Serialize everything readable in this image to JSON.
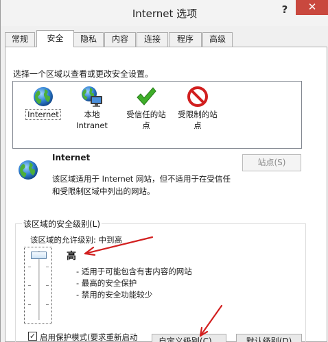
{
  "window": {
    "title": "Internet 选项",
    "help_label": "?",
    "close_label": "✕"
  },
  "tabs": [
    {
      "label": "常规"
    },
    {
      "label": "安全"
    },
    {
      "label": "隐私"
    },
    {
      "label": "内容"
    },
    {
      "label": "连接"
    },
    {
      "label": "程序"
    },
    {
      "label": "高级"
    }
  ],
  "active_tab": "安全",
  "security": {
    "instruction": "选择一个区域以查看或更改安全设置。",
    "zones": [
      {
        "line1": "Internet",
        "line2": "",
        "icon": "globe-icon"
      },
      {
        "line1": "本地",
        "line2": "Intranet",
        "icon": "intranet-icon"
      },
      {
        "line1": "受信任的站",
        "line2": "点",
        "icon": "checkmark-icon"
      },
      {
        "line1": "受限制的站",
        "line2": "点",
        "icon": "prohibited-icon"
      }
    ],
    "selected_zone": {
      "name": "Internet",
      "desc_line1": "该区域适用于 Internet 网站，但不适用于在受信任",
      "desc_line2": "和受限制区域中列出的网站。",
      "sites_button": "站点(S)"
    },
    "level_group": {
      "title": "该区域的安全级别(L)",
      "allowed_levels": "该区域的允许级别: 中到高",
      "current_level": "高",
      "bullets": [
        "- 适用于可能包含有害内容的网站",
        "- 最高的安全保护",
        "- 禁用的安全功能较少"
      ],
      "slider_level": "高"
    },
    "protected_mode": {
      "label": "启用保护模式(要求重新启动",
      "checked": true
    },
    "buttons": {
      "custom_level": "自定义级别(C)...",
      "default_level": "默认级别(D)"
    }
  },
  "colors": {
    "close_button": "#c9483e",
    "annotation_arrow": "#d21f1f",
    "slider_thumb_border": "#5a7fa5"
  }
}
